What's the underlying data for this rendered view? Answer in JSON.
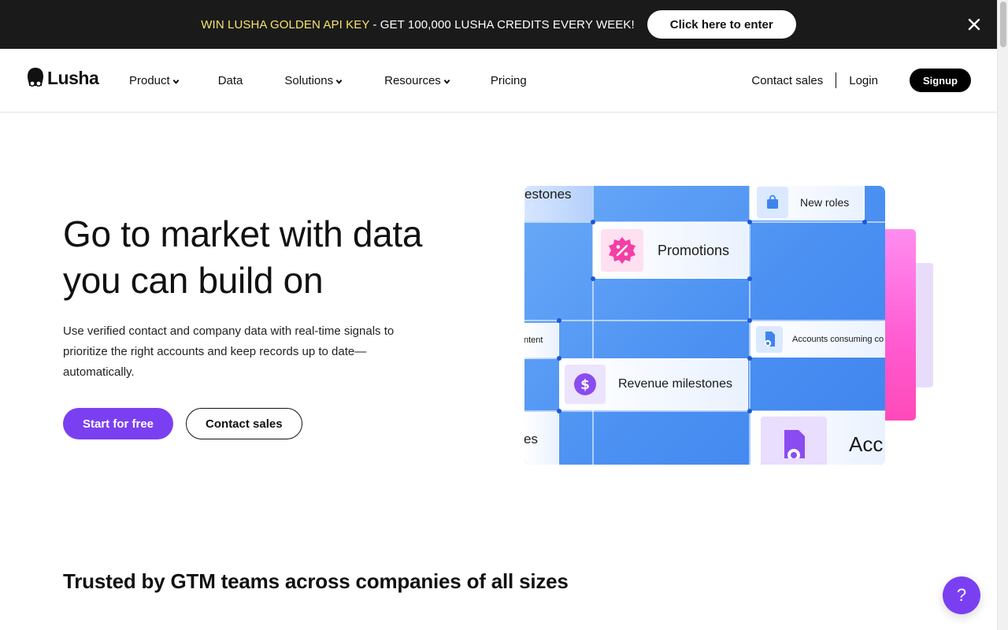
{
  "promo": {
    "highlight": "WIN LUSHA GOLDEN API KEY",
    "text": " - GET 100,000 LUSHA CREDITS EVERY WEEK!",
    "button_label": "Click here to enter",
    "close_icon": "close-icon"
  },
  "nav": {
    "logo": "Lusha",
    "items": [
      {
        "label": "Product",
        "has_dropdown": true
      },
      {
        "label": "Data",
        "has_dropdown": false
      },
      {
        "label": "Solutions",
        "has_dropdown": true
      },
      {
        "label": "Resources",
        "has_dropdown": true
      },
      {
        "label": "Pricing",
        "has_dropdown": false
      }
    ],
    "contact_sales": "Contact sales",
    "login": "Login",
    "signup": "Signup"
  },
  "hero": {
    "title_line1": "Go to market with data",
    "title_line2": "you can build on",
    "subtitle": "Use verified contact and company data with real-time signals to prioritize the right accounts and keep records up to date—automatically.",
    "primary_cta": "Start for free",
    "secondary_cta": "Contact sales"
  },
  "illustration": {
    "cards": {
      "milestones_fragment": "estones",
      "new_roles": "New roles",
      "promotions": "Promotions",
      "content_fragment": "ntent",
      "accounts_consuming": "Accounts consuming co",
      "revenue_milestones": "Revenue milestones",
      "es_fragment": "es",
      "acc_fragment": "Acc"
    }
  },
  "trusted": {
    "heading": "Trusted by GTM teams across companies of all sizes"
  },
  "help": {
    "label": "?"
  },
  "colors": {
    "accent": "#7b3ff2",
    "banner_bg": "#1a1a1a",
    "banner_highlight": "#f5e66a",
    "illustration_blue": "#4b90f2",
    "illustration_pink": "#ff5ad0"
  }
}
